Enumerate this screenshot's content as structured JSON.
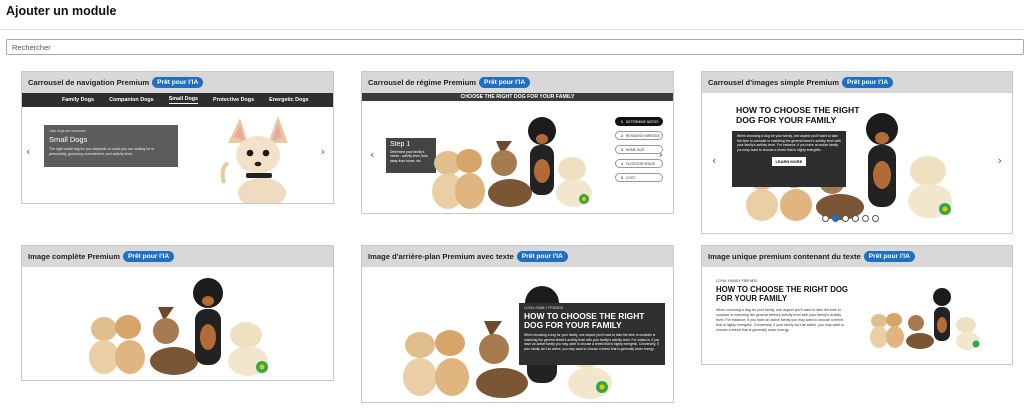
{
  "page": {
    "title": "Ajouter un module",
    "search_placeholder": "Rechercher"
  },
  "badge_label": "Prêt pour l'IA",
  "colors": {
    "badge": "#1f6fc2",
    "card_header": "#d8d8d8",
    "nav_bar": "#2e2e2e"
  },
  "modules": [
    {
      "title": "Carrousel de navigation Premium",
      "nav_items": [
        "Family Dogs",
        "Companion Dogs",
        "Small Dogs",
        "Protective Dogs",
        "Energetic Dogs"
      ],
      "active_nav": "Small Dogs",
      "kicker": "Little dogs are awesome",
      "heading": "Small Dogs",
      "body": "The right small dog for you depends on what you are looking for in personality, grooming commitment, and activity level."
    },
    {
      "title": "Carrousel de régime Premium",
      "banner": "CHOOSE THE RIGHT DOG FOR YOUR FAMILY",
      "step_title": "Step 1",
      "step_body": "Determine your family's needs - activity level, time away from home, etc.",
      "steps": [
        "DETERMINE NEEDS",
        "RESEARCH BREEDS",
        "HOME SIZE",
        "OUTDOOR SPACE",
        "COST"
      ]
    },
    {
      "title": "Carrousel d'images simple Premium",
      "heading": "HOW TO CHOOSE THE RIGHT DOG FOR YOUR FAMILY",
      "body": "When choosing a dog for your family, one aspect you'll want to take the time to consider is matching the general breed's activity level with your family's activity level. For instance, if you have an active family you may want to choose a breed that is highly energetic.",
      "cta": "LEARN MORE",
      "dot_count": 6,
      "active_dot": 1
    },
    {
      "title": "Image complète Premium"
    },
    {
      "title": "Image d'arrière-plan Premium avec texte",
      "kicker": "LOYAL FAMILY FRIENDS",
      "heading": "HOW TO CHOOSE THE RIGHT DOG FOR YOUR FAMILY",
      "body": "When choosing a dog for your family, one aspect you'll want to take the time to consider is matching the general breed's activity level with your family's activity level. For instance, if you have an active family you may want to choose a breed that is highly energetic. Conversely, if your family isn't as active, you may want to choose a breed that is generally lower energy."
    },
    {
      "title": "Image unique premium contenant du texte",
      "kicker": "LOYAL FAMILY FRIENDS",
      "heading": "HOW TO CHOOSE THE RIGHT DOG FOR YOUR FAMILY",
      "body": "When choosing a dog for your family, one aspect you'll want to take the time to consider is matching the general breed's activity level with your family's activity level. For instance, if you have an active family you may want to choose a breed that is highly energetic. Conversely, if your family isn't as active, you may want to choose a breed that is generally lower energy."
    }
  ]
}
